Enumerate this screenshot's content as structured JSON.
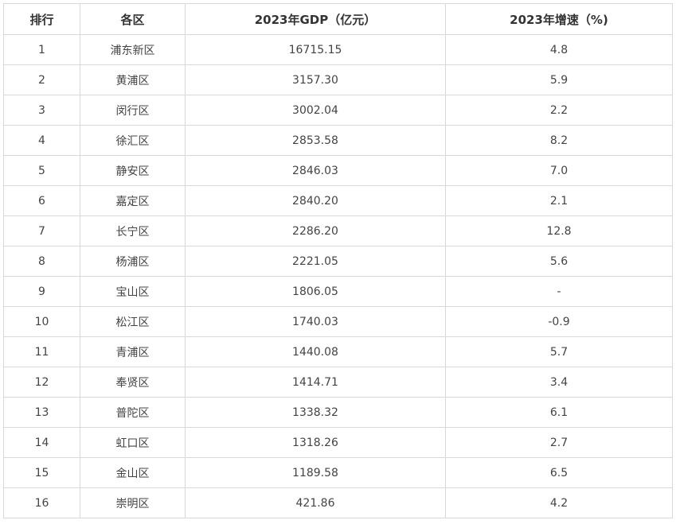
{
  "table": {
    "headers": [
      "排行",
      "各区",
      "2023年GDP（亿元）",
      "2023年增速（%)"
    ],
    "rows": [
      [
        "1",
        "浦东新区",
        "16715.15",
        "4.8"
      ],
      [
        "2",
        "黄浦区",
        "3157.30",
        "5.9"
      ],
      [
        "3",
        "闵行区",
        "3002.04",
        "2.2"
      ],
      [
        "4",
        "徐汇区",
        "2853.58",
        "8.2"
      ],
      [
        "5",
        "静安区",
        "2846.03",
        "7.0"
      ],
      [
        "6",
        "嘉定区",
        "2840.20",
        "2.1"
      ],
      [
        "7",
        "长宁区",
        "2286.20",
        "12.8"
      ],
      [
        "8",
        "杨浦区",
        "2221.05",
        "5.6"
      ],
      [
        "9",
        "宝山区",
        "1806.05",
        "-"
      ],
      [
        "10",
        "松江区",
        "1740.03",
        "-0.9"
      ],
      [
        "11",
        "青浦区",
        "1440.08",
        "5.7"
      ],
      [
        "12",
        "奉贤区",
        "1414.71",
        "3.4"
      ],
      [
        "13",
        "普陀区",
        "1338.32",
        "6.1"
      ],
      [
        "14",
        "虹口区",
        "1318.26",
        "2.7"
      ],
      [
        "15",
        "金山区",
        "1189.58",
        "6.5"
      ],
      [
        "16",
        "崇明区",
        "421.86",
        "4.2"
      ]
    ]
  }
}
